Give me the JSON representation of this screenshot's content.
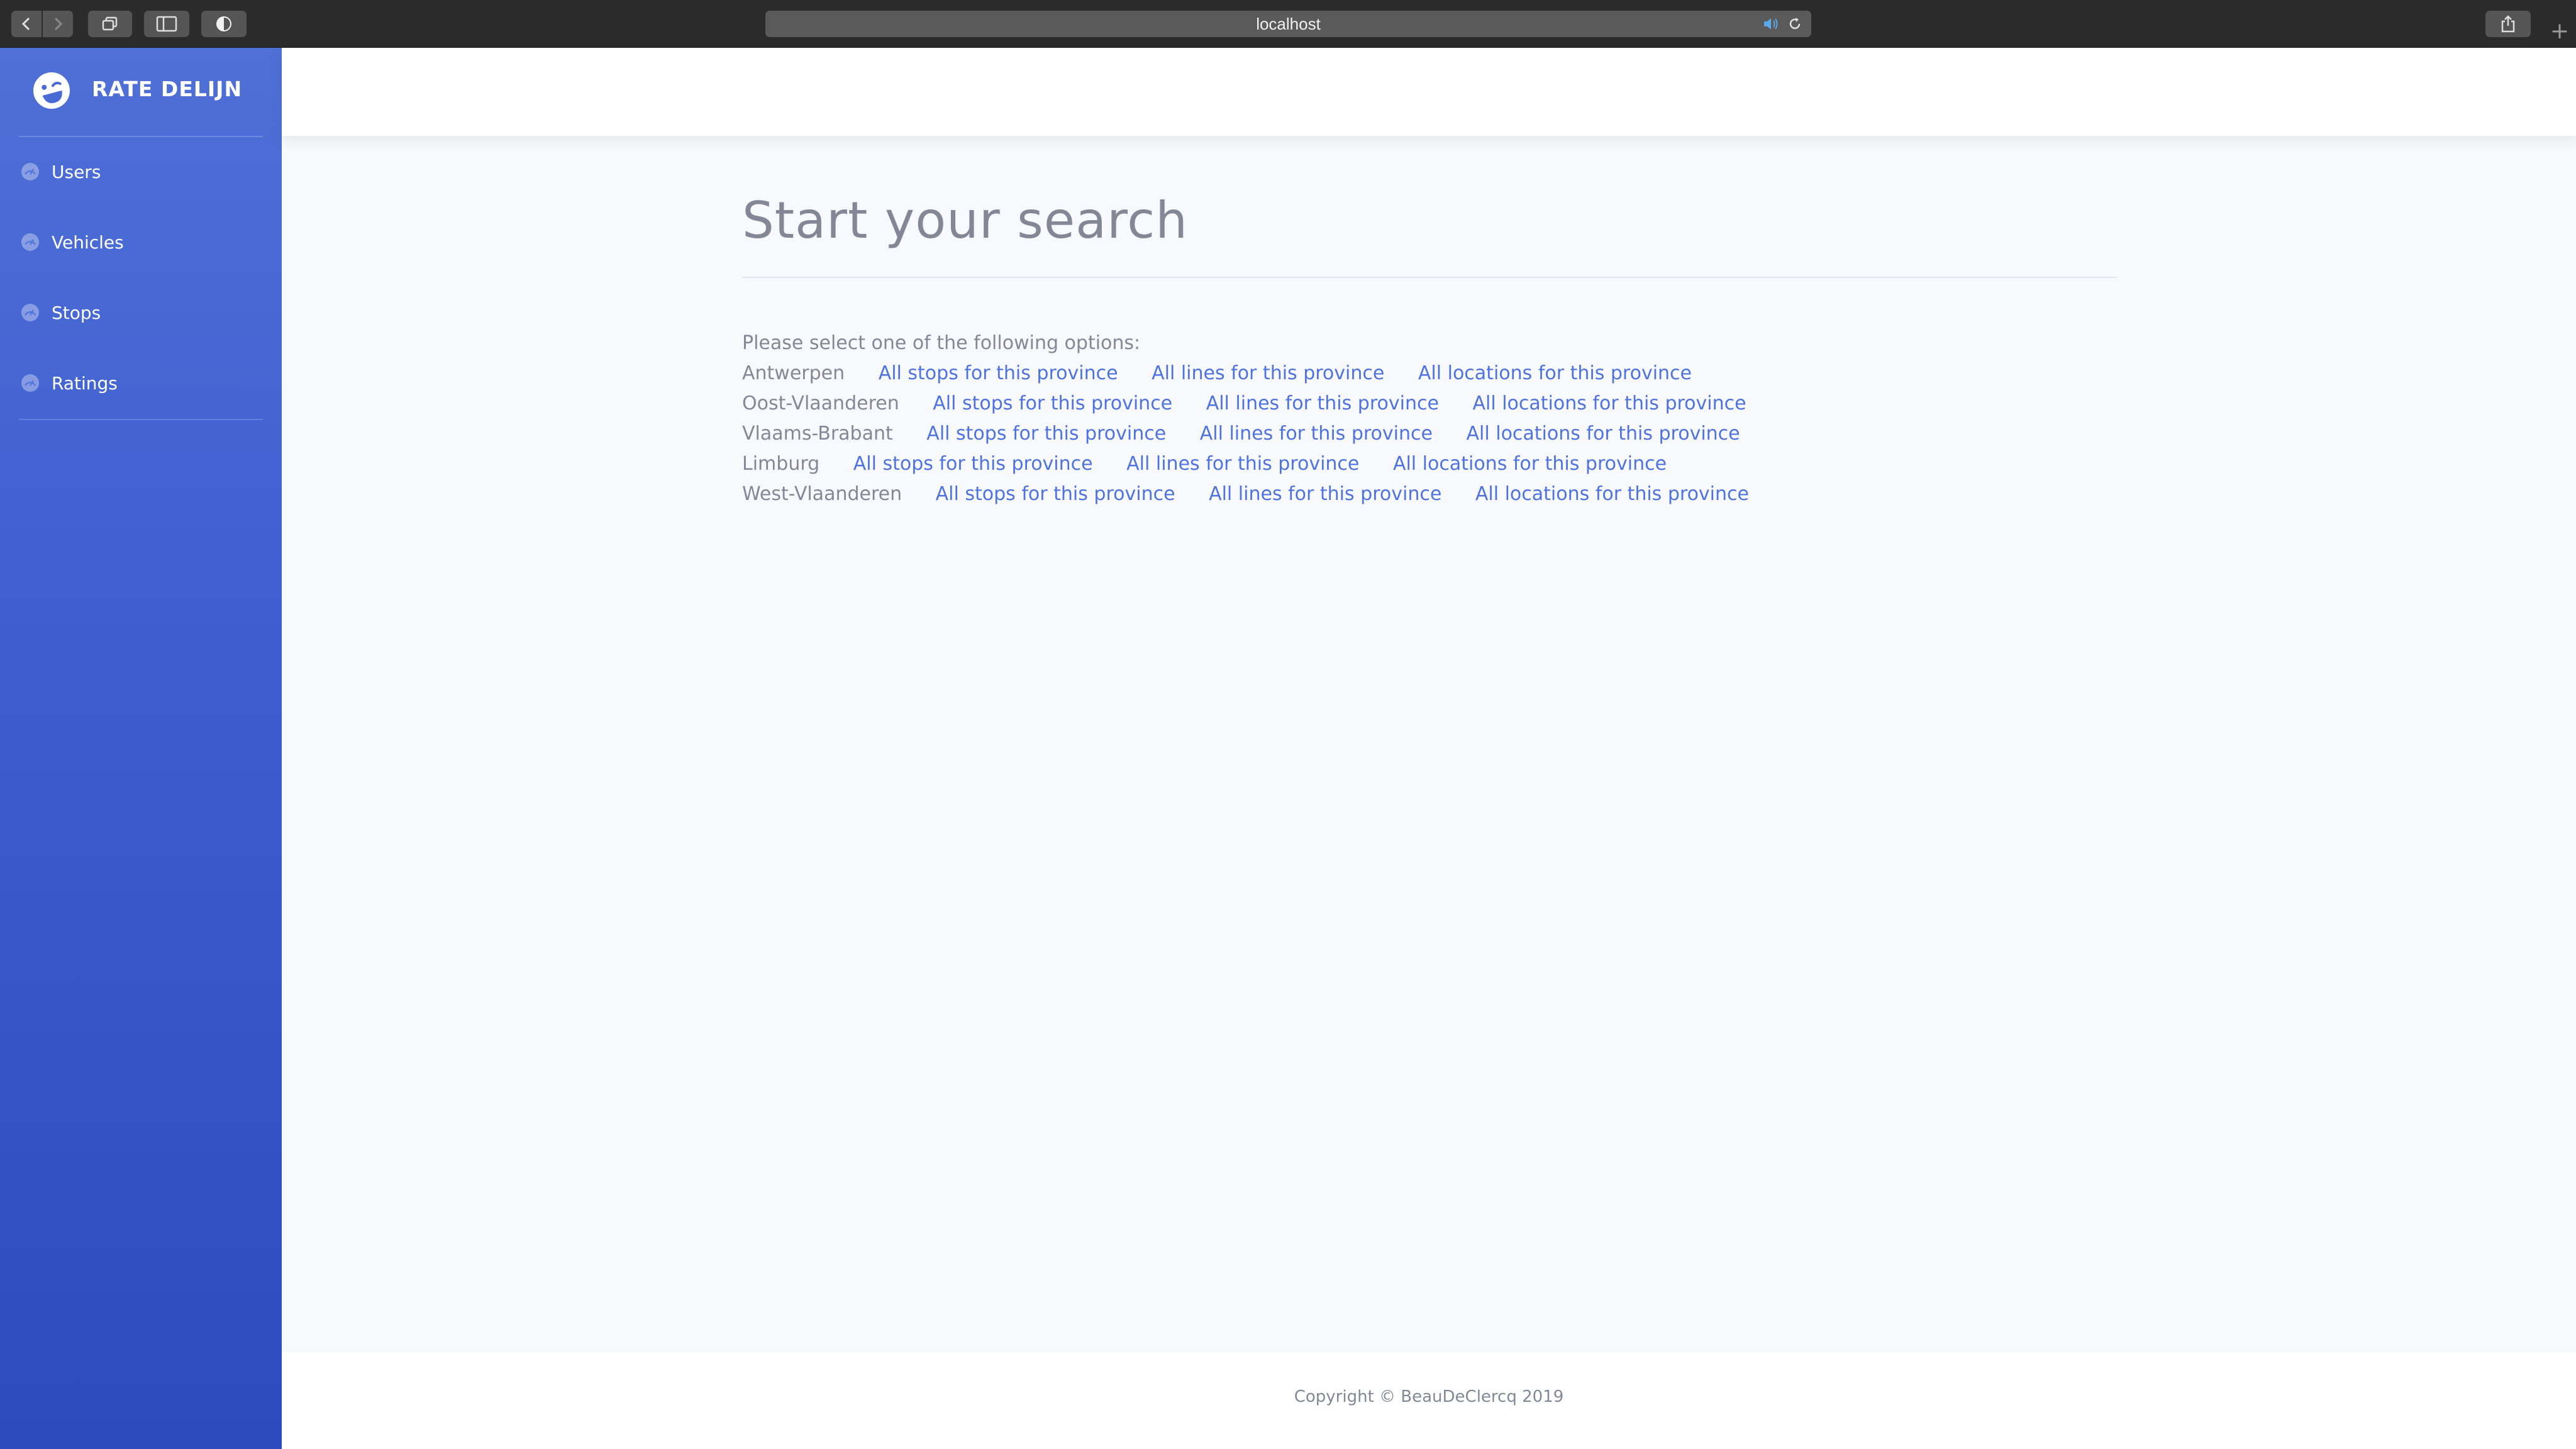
{
  "browser": {
    "address": "localhost"
  },
  "sidebar": {
    "brand": "RATE DELIJN",
    "items": [
      {
        "label": "Users",
        "icon": "dashboard-gauge-icon"
      },
      {
        "label": "Vehicles",
        "icon": "dashboard-gauge-icon"
      },
      {
        "label": "Stops",
        "icon": "dashboard-gauge-icon"
      },
      {
        "label": "Ratings",
        "icon": "dashboard-gauge-icon"
      }
    ]
  },
  "main": {
    "title": "Start your search",
    "intro": "Please select one of the following options:",
    "provinces": [
      {
        "name": "Antwerpen",
        "links": [
          "All stops for this province",
          "All lines for this province",
          "All locations for this province"
        ]
      },
      {
        "name": "Oost-Vlaanderen",
        "links": [
          "All stops for this province",
          "All lines for this province",
          "All locations for this province"
        ]
      },
      {
        "name": "Vlaams-Brabant",
        "links": [
          "All stops for this province",
          "All lines for this province",
          "All locations for this province"
        ]
      },
      {
        "name": "Limburg",
        "links": [
          "All stops for this province",
          "All lines for this province",
          "All locations for this province"
        ]
      },
      {
        "name": "West-Vlaanderen",
        "links": [
          "All stops for this province",
          "All lines for this province",
          "All locations for this province"
        ]
      }
    ]
  },
  "footer": {
    "copyright": "Copyright © BeauDeClercq 2019"
  },
  "colors": {
    "sidebar_top": "#4f70d6",
    "sidebar_bottom": "#2c4bbd",
    "link": "#4e73df",
    "muted_text": "#858796",
    "page_bg": "#f8f9fc"
  }
}
